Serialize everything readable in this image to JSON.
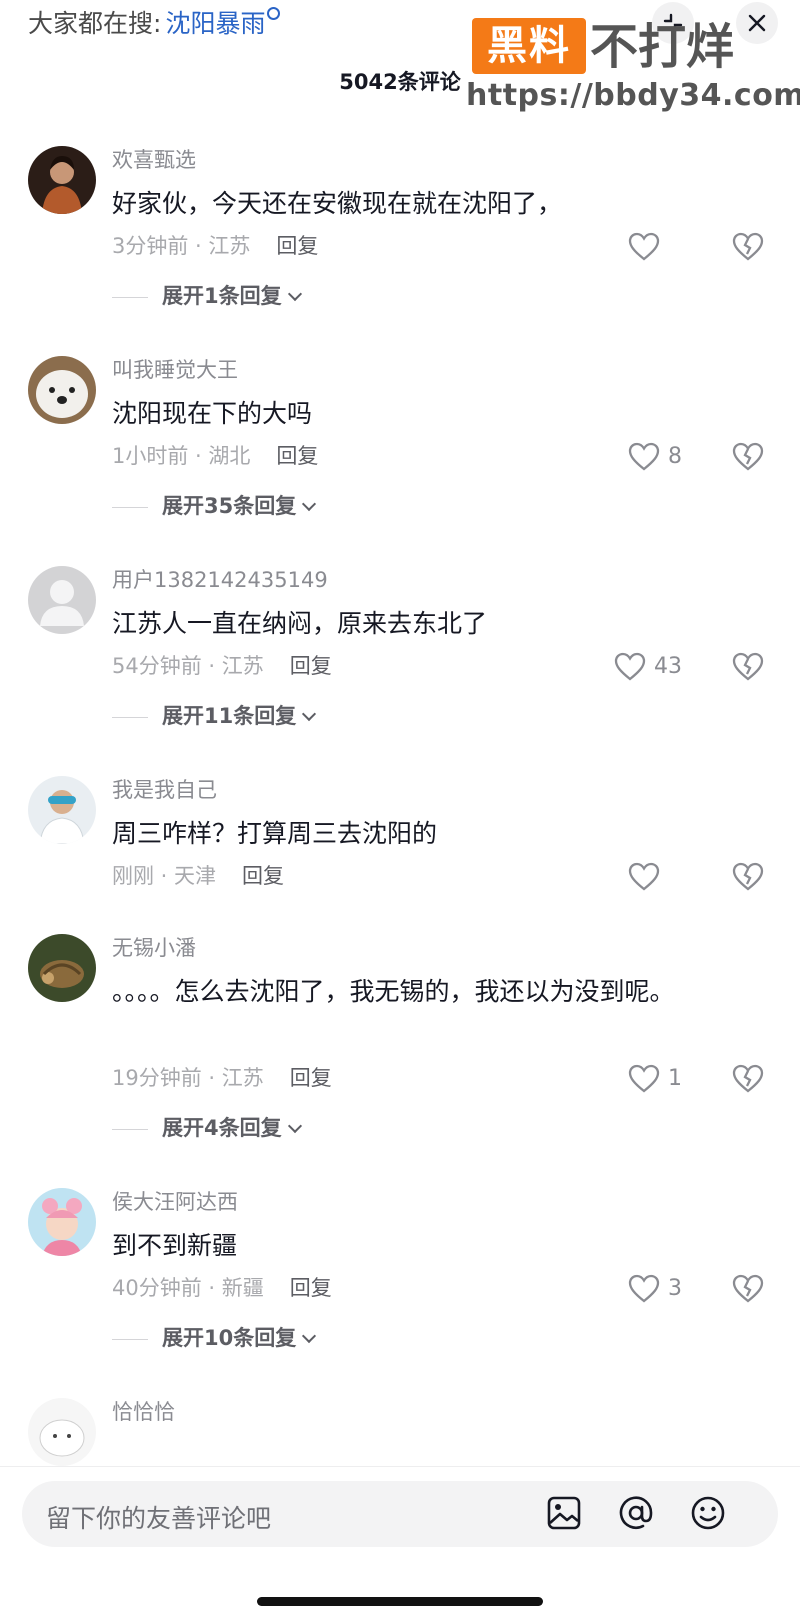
{
  "topbar": {
    "search_prefix": "大家都在搜:",
    "search_keyword": "沈阳暴雨",
    "comment_count": "5042条评论",
    "collapse_icon": "collapse-icon",
    "close_icon": "close-icon"
  },
  "watermark": {
    "badge": "黑料",
    "title": "不打烊",
    "url": "https://bbdy34.com"
  },
  "comments": [
    {
      "username": "欢喜甄选",
      "text": "好家伙，今天还在安徽现在就在沈阳了，",
      "meta": "3分钟前 · 江苏",
      "reply": "回复",
      "likes": "",
      "expand": "展开1条回复"
    },
    {
      "username": "叫我睡觉大王",
      "text": "沈阳现在下的大吗",
      "meta": "1小时前 · 湖北",
      "reply": "回复",
      "likes": "8",
      "expand": "展开35条回复"
    },
    {
      "username": "用户1382142435149",
      "text": "江苏人一直在纳闷，原来去东北了",
      "meta": "54分钟前 · 江苏",
      "reply": "回复",
      "likes": "43",
      "expand": "展开11条回复"
    },
    {
      "username": "我是我自己",
      "text": "周三咋样？打算周三去沈阳的",
      "meta": "刚刚 · 天津",
      "reply": "回复",
      "likes": "",
      "expand": ""
    },
    {
      "username": "无锡小潘",
      "text": "。。。。怎么去沈阳了，我无锡的，我还以为没到呢。",
      "meta": "19分钟前 · 江苏",
      "reply": "回复",
      "likes": "1",
      "expand": "展开4条回复"
    },
    {
      "username": "侯大汪阿达西",
      "text": "到不到新疆",
      "meta": "40分钟前 · 新疆",
      "reply": "回复",
      "likes": "3",
      "expand": "展开10条回复"
    },
    {
      "username": "恰恰恰",
      "text": "",
      "meta": "",
      "reply": "",
      "likes": "",
      "expand": ""
    }
  ],
  "input": {
    "placeholder": "留下你的友善评论吧",
    "icons": [
      "image-icon",
      "at-icon",
      "emoji-icon"
    ]
  },
  "colors": {
    "keyword": "#2a64c6",
    "watermark_badge": "#f47a17",
    "secondary_text": "#8a8b91"
  }
}
